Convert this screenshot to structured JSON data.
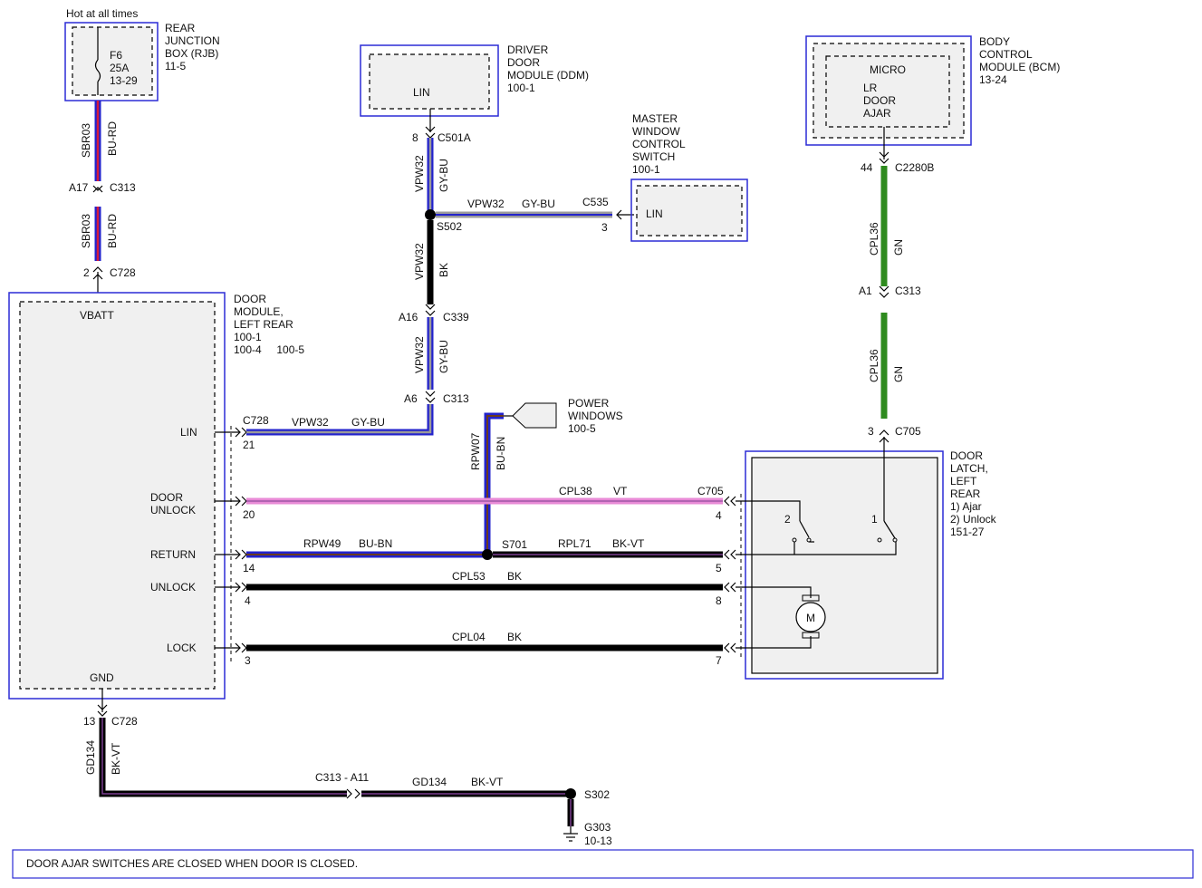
{
  "header": {
    "hot_at_all_times": "Hot at all times"
  },
  "modules": {
    "rjb": {
      "lines": [
        "REAR",
        "JUNCTION",
        "BOX (RJB)",
        "11-5"
      ]
    },
    "fuse": {
      "lines": [
        "F6",
        "25A",
        "13-29"
      ]
    },
    "ddm": {
      "lines": [
        "DRIVER",
        "DOOR",
        "MODULE (DDM)",
        "100-1"
      ],
      "inner": "LIN"
    },
    "master_switch": {
      "lines": [
        "MASTER",
        "WINDOW",
        "CONTROL",
        "SWITCH",
        "100-1"
      ],
      "inner": "LIN"
    },
    "bcm": {
      "lines": [
        "BODY",
        "CONTROL",
        "MODULE (BCM)",
        "13-24"
      ],
      "inner_title": "MICRO",
      "inner_lines": [
        "LR",
        "DOOR",
        "AJAR"
      ]
    },
    "door_module": {
      "lines": [
        "DOOR",
        "MODULE,",
        "LEFT REAR",
        "100-1",
        "100-4     100-5"
      ],
      "vbatt": "VBATT",
      "gnd": "GND",
      "pins": [
        "LIN",
        "DOOR",
        "UNLOCK",
        "RETURN",
        "UNLOCK",
        "LOCK"
      ]
    },
    "power_windows": {
      "lines": [
        "POWER",
        "WINDOWS",
        "100-5"
      ]
    },
    "door_latch": {
      "lines": [
        "DOOR",
        "LATCH,",
        "LEFT",
        "REAR",
        "1) Ajar",
        "2) Unlock",
        "151-27"
      ],
      "motor": "M",
      "switch_1": "1",
      "switch_2": "2"
    }
  },
  "wires": {
    "sbr03_a": {
      "circuit": "SBR03",
      "color": "BU-RD"
    },
    "sbr03_b": {
      "circuit": "SBR03",
      "color": "BU-RD"
    },
    "vpw32_a": {
      "circuit": "VPW32",
      "color": "GY-BU"
    },
    "vpw32_h": {
      "circuit": "VPW32",
      "color": "GY-BU"
    },
    "vpw32_bk": {
      "circuit": "VPW32",
      "color": "BK"
    },
    "vpw32_c": {
      "circuit": "VPW32",
      "color": "GY-BU"
    },
    "vpw32_lin": {
      "circuit": "VPW32",
      "color": "GY-BU"
    },
    "rpw07": {
      "circuit": "RPW07",
      "color": "BU-BN"
    },
    "cpl38": {
      "circuit": "CPL38",
      "color": "VT"
    },
    "rpw49": {
      "circuit": "RPW49",
      "color": "BU-BN"
    },
    "rpl71": {
      "circuit": "RPL71",
      "color": "BK-VT"
    },
    "cpl53": {
      "circuit": "CPL53",
      "color": "BK"
    },
    "cpl04": {
      "circuit": "CPL04",
      "color": "BK"
    },
    "cpl36_a": {
      "circuit": "CPL36",
      "color": "GN"
    },
    "cpl36_b": {
      "circuit": "CPL36",
      "color": "GN"
    },
    "gd134_v": {
      "circuit": "GD134",
      "color": "BK-VT"
    },
    "gd134_h": {
      "circuit": "GD134",
      "color": "BK-VT"
    }
  },
  "connectors": {
    "a17": "A17",
    "c313_1": "C313",
    "pin2": "2",
    "c728_1": "C728",
    "pin8": "8",
    "c501a": "C501A",
    "s502": "S502",
    "c535": "C535",
    "pin3_c535": "3",
    "a16": "A16",
    "c339": "C339",
    "a6": "A6",
    "c313_2": "C313",
    "c728_lin": "C728",
    "pin21": "21",
    "pin20": "20",
    "pin14": "14",
    "pin4_left": "4",
    "pin3_left": "3",
    "c705_row": "C705",
    "pin4_right": "4",
    "pin5_right": "5",
    "pin8_right": "8",
    "pin7_right": "7",
    "s701": "S701",
    "pin44": "44",
    "c2280b": "C2280B",
    "a1": "A1",
    "c313_3": "C313",
    "pin3_top": "3",
    "c705_top": "C705",
    "pin13": "13",
    "c728_gnd": "C728",
    "c313_a11": "C313 - A11",
    "s302": "S302",
    "g303": "G303",
    "g303_ref": "10-13"
  },
  "note": "DOOR AJAR SWITCHES ARE CLOSED WHEN DOOR IS CLOSED.",
  "colors": {
    "blue": "#2222cc",
    "red": "#d21c3c",
    "gray": "#9a9a9a",
    "pink": "#e88ad6",
    "violet": "#7a3d8f",
    "brown": "#6b3a1f",
    "green": "#2e8b1e",
    "black": "#000000"
  }
}
